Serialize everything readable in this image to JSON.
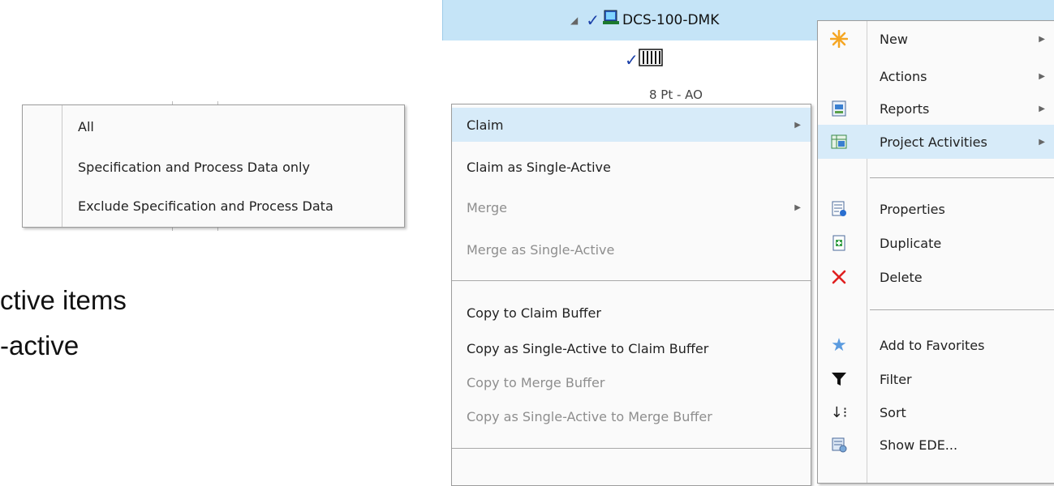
{
  "tree": {
    "node_label": "DCS-100-DMK",
    "collapse_glyph": "◢",
    "peek_label": "8 Pt - AO"
  },
  "background_text": {
    "line1": "ctive items",
    "line2": "-active"
  },
  "context_menu": {
    "items": [
      {
        "label": "New",
        "icon": "new-star-icon"
      },
      {
        "label": "Actions",
        "icon": ""
      },
      {
        "label": "Reports",
        "icon": "reports-icon"
      },
      {
        "label": "Project Activities",
        "icon": "project-activities-icon"
      },
      {
        "label": "Properties",
        "icon": "properties-icon"
      },
      {
        "label": "Duplicate",
        "icon": "duplicate-icon"
      },
      {
        "label": "Delete",
        "icon": "delete-icon"
      },
      {
        "label": "Add to Favorites",
        "icon": "favorites-star-icon"
      },
      {
        "label": "Filter",
        "icon": "filter-icon"
      },
      {
        "label": "Sort",
        "icon": "sort-icon"
      },
      {
        "label": "Show EDE...",
        "icon": "show-ede-icon"
      }
    ]
  },
  "project_activities_menu": {
    "items": [
      {
        "label": "Claim",
        "enabled": true
      },
      {
        "label": "Claim as Single-Active",
        "enabled": true
      },
      {
        "label": "Merge",
        "enabled": false
      },
      {
        "label": "Merge as Single-Active",
        "enabled": false
      },
      {
        "label": "Copy to Claim Buffer",
        "enabled": true
      },
      {
        "label": "Copy as Single-Active to Claim Buffer",
        "enabled": true
      },
      {
        "label": "Copy to Merge Buffer",
        "enabled": false
      },
      {
        "label": "Copy as Single-Active to Merge Buffer",
        "enabled": false
      }
    ]
  },
  "claim_menu": {
    "items": [
      {
        "label": "All"
      },
      {
        "label": "Specification and Process Data only"
      },
      {
        "label": "Exclude Specification and Process Data"
      }
    ]
  },
  "colors": {
    "selection": "#c5e4f7",
    "highlight": "#d7ebf9",
    "accent_blue": "#1a3fa8",
    "delete_red": "#e02020"
  }
}
